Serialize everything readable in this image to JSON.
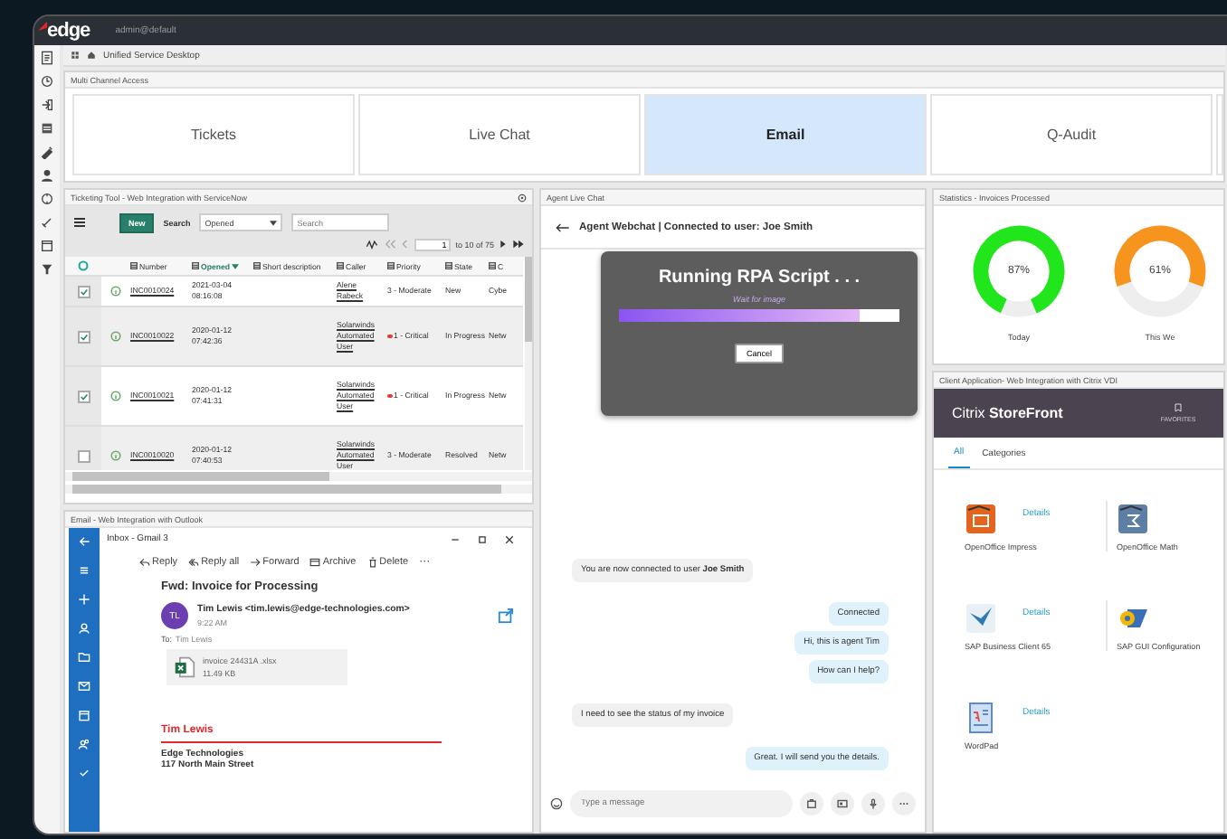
{
  "header": {
    "logo": "edge",
    "user": "admin@default"
  },
  "breadcrumb": {
    "title": "Unified Service Desktop"
  },
  "channels": {
    "title": "Multi Channel Access",
    "tiles": [
      {
        "label": "Tickets",
        "selected": false
      },
      {
        "label": "Live Chat",
        "selected": false
      },
      {
        "label": "Email",
        "selected": true
      },
      {
        "label": "Q-Audit",
        "selected": false
      }
    ]
  },
  "ticketing": {
    "title": "Ticketing Tool - Web Integration with ServiceNow",
    "new_button": "New",
    "search_label": "Search",
    "search_filter": "Opened",
    "search_placeholder": "Search",
    "page": "1",
    "page_total": "to 10 of 75",
    "columns": [
      {
        "label": "Number",
        "sorted": false
      },
      {
        "label": "Opened",
        "sorted": true
      },
      {
        "label": "Short description",
        "sorted": false
      },
      {
        "label": "Caller",
        "sorted": false
      },
      {
        "label": "Priority",
        "sorted": false
      },
      {
        "label": "State",
        "sorted": false
      },
      {
        "label": "C",
        "sorted": false
      }
    ],
    "rows": [
      {
        "checked": true,
        "number": "INC0010024",
        "opened": "2021-03-04 08:16:08",
        "caller": "Alene Rabeck",
        "priority": "3 - Moderate",
        "critical": false,
        "state": "New",
        "column_9": "Cybe"
      },
      {
        "checked": true,
        "number": "INC0010022",
        "opened": "2020-01-12 07:42:36",
        "caller": "Solarwinds Automated User",
        "priority": "1 - Critical",
        "critical": true,
        "state": "In Progress",
        "column_9": "Netw"
      },
      {
        "checked": true,
        "number": "INC0010021",
        "opened": "2020-01-12 07:41:31",
        "caller": "Solarwinds Automated User",
        "priority": "1 - Critical",
        "critical": true,
        "state": "In Progress",
        "column_9": "Netw"
      },
      {
        "checked": false,
        "number": "INC0010020",
        "opened": "2020-01-12 07:40:53",
        "caller": "Solarwinds Automated User",
        "priority": "3 - Moderate",
        "critical": false,
        "state": "Resolved",
        "column_9": "Netw"
      }
    ]
  },
  "email": {
    "title": "Email - Web Integration with Outlook",
    "window_title": "Inbox - Gmail 3",
    "toolbar": [
      "Reply",
      "Reply all",
      "Forward",
      "Archive",
      "Delete"
    ],
    "more": "···",
    "subject": "Fwd: Invoice for Processing",
    "avatar": "TL",
    "sender": "Tim Lewis <tim.lewis@edge-technologies.com>",
    "time": "9:22 AM",
    "to_label": "To:",
    "to": "Tim Lewis",
    "attachment": {
      "name": "invoice 24431A .xlsx",
      "size": "11.49 KB"
    },
    "signature_name": "Tim Lewis",
    "signature_lines": [
      "Edge Technologies",
      "117 North Main Street"
    ]
  },
  "chat": {
    "title": "Agent Live Chat",
    "heading": "Agent Webchat | Connected to user: Joe Smith",
    "modal": {
      "title": "Running RPA Script . . .",
      "subtitle": "Wait for image",
      "level": 0.86,
      "button": "Cancel"
    },
    "messages": [
      {
        "kind": "system",
        "text": "You are now connected to user **Joe Smith**"
      },
      {
        "kind": "agent",
        "text": "Connected"
      },
      {
        "kind": "agent",
        "text": "Hi, this is agent Tim"
      },
      {
        "kind": "agent",
        "text": "How can I help?"
      },
      {
        "kind": "user",
        "text": "I need to see the status of my invoice"
      },
      {
        "kind": "agent",
        "text": "Great. I will send you the details."
      }
    ],
    "placeholder": "Type a message"
  },
  "statistics": {
    "title": "Statistics - Invoices Processed",
    "gauges": [
      {
        "reading": "87%",
        "label": "Today",
        "level": 0.87,
        "color": "#22e61c"
      },
      {
        "reading": "61%",
        "label": "This We",
        "level": 0.61,
        "color": "#f7941d"
      }
    ]
  },
  "citrix": {
    "title": "Client Application- Web Integration with Citrix VDI",
    "brand": "Citrix **StoreFront**",
    "favorites": "FAVORITES",
    "tabs": [
      {
        "label": "All",
        "selected": true
      },
      {
        "label": "Categories",
        "selected": false
      }
    ],
    "apps": [
      {
        "name": "OpenOffice Impress",
        "details": "Details",
        "kind": "impress"
      },
      {
        "name": "OpenOffice Math",
        "kind": "math"
      },
      {
        "name": "SAP Business Client 65",
        "details": "Details",
        "kind": "sapclient"
      },
      {
        "name": "SAP GUI Configuration",
        "kind": "sapgui"
      },
      {
        "name": "WordPad",
        "details": "Details",
        "kind": "wordpad"
      }
    ]
  }
}
